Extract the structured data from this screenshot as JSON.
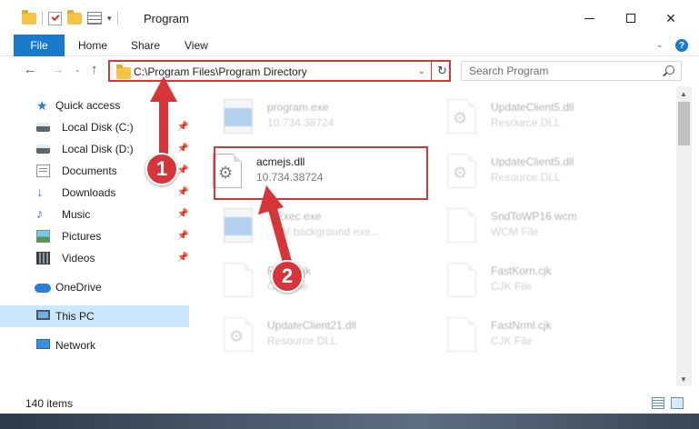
{
  "window": {
    "title": "Program",
    "buttons": {
      "minimize": "—",
      "maximize": "",
      "close": "✕"
    }
  },
  "ribbon": {
    "tabs": {
      "file": "File",
      "home": "Home",
      "share": "Share",
      "view": "View"
    },
    "help": "?",
    "collapse": "⌄"
  },
  "navigation": {
    "back": "←",
    "forward": "→",
    "recent": "⌄",
    "up": "↑",
    "address": "C:\\Program Files\\Program Directory",
    "dropdown": "⌄",
    "refresh": "↻",
    "search_placeholder": "Search Program"
  },
  "sidebar": {
    "pin": "📌",
    "items": [
      {
        "label": "Quick access",
        "icon": "star-icon"
      },
      {
        "label": "Local Disk (C:)",
        "icon": "drive-icon"
      },
      {
        "label": "Local Disk (D:)",
        "icon": "drive-icon"
      },
      {
        "label": "Documents",
        "icon": "documents-icon"
      },
      {
        "label": "Downloads",
        "icon": "downloads-icon"
      },
      {
        "label": "Music",
        "icon": "music-icon"
      },
      {
        "label": "Pictures",
        "icon": "pictures-icon"
      },
      {
        "label": "Videos",
        "icon": "videos-icon"
      },
      {
        "label": "OneDrive",
        "icon": "cloud-icon"
      },
      {
        "label": "This PC",
        "icon": "computer-icon"
      },
      {
        "label": "Network",
        "icon": "network-icon"
      }
    ]
  },
  "files": [
    {
      "name": "program.exe",
      "sub": "10.734.38724",
      "icon": "exe-icon"
    },
    {
      "name": "UpdateClient5.dll",
      "sub": "Resource DLL",
      "icon": "dll-icon"
    },
    {
      "name": "acmejs.dll",
      "sub": "10.734.38724",
      "icon": "dll-icon"
    },
    {
      "name": "UpdateClient5.dll",
      "sub": "Resource DLL",
      "icon": "dll-icon"
    },
    {
      "name": "...Exec.exe",
      "sub": "...AV background exe...",
      "icon": "exe-icon"
    },
    {
      "name": "SndToWP16.wcm",
      "sub": "WCM File",
      "icon": "file-icon"
    },
    {
      "name": "Fast...cjk",
      "sub": "CJK File",
      "icon": "file-icon"
    },
    {
      "name": "FastKorn.cjk",
      "sub": "CJK File",
      "icon": "file-icon"
    },
    {
      "name": "UpdateClient21.dll",
      "sub": "Resource DLL",
      "icon": "dll-icon"
    },
    {
      "name": "FastNrml.cjk",
      "sub": "CJK File",
      "icon": "file-icon"
    }
  ],
  "annotations": {
    "step1": "1",
    "step2": "2",
    "accent_color": "#d6363a"
  },
  "status": {
    "item_count": "140 items"
  },
  "scroll": {
    "up": "▲",
    "down": "▼"
  }
}
